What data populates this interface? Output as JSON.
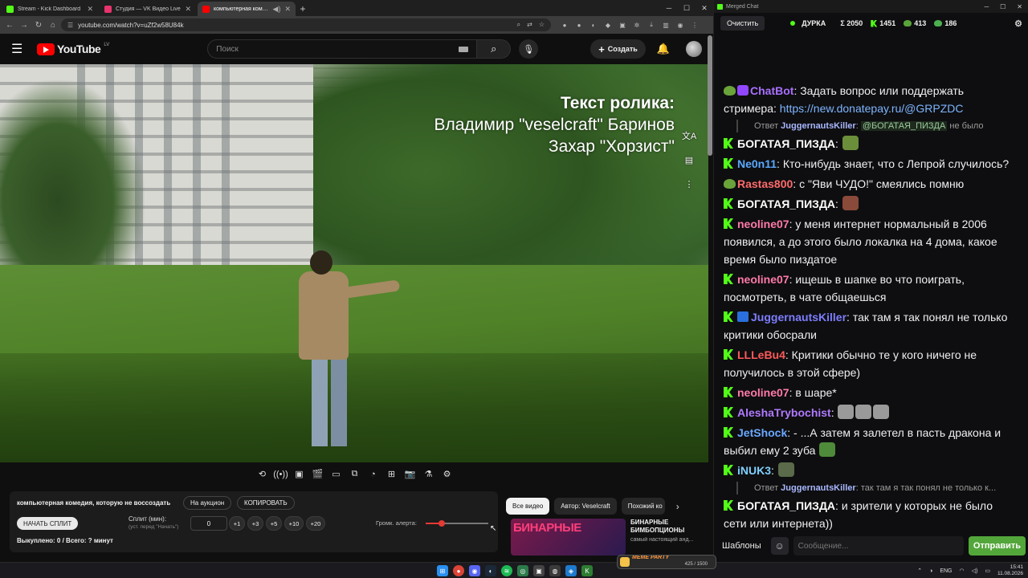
{
  "browser": {
    "tabs": [
      {
        "label": "Stream - Kick Dashboard",
        "fav_color": "#53fc18"
      },
      {
        "label": "Студия — VK Видео Live",
        "fav_color": "#e8336d"
      },
      {
        "label": "компьютерная комедия, к",
        "fav_color": "#ff0000"
      }
    ],
    "url": "youtube.com/watch?v=uZf2w58U84k"
  },
  "youtube": {
    "logo_text": "YouTube",
    "region": "LV",
    "search_placeholder": "Поиск",
    "create_label": "Создать"
  },
  "video": {
    "credits_title": "Текст ролика:",
    "credits_line1": "Владимир \"veselcraft\" Баринов",
    "credits_line2": "Захар \"Хорзист\""
  },
  "panel": {
    "title": "компьютерная комедия, которую не воссоздать",
    "auction_label": "На аукцион",
    "copy_label": "КОПИРОВАТЬ",
    "start_split_label": "НАЧАТЬ СПЛИТ",
    "split_label": "Сплит (мин):",
    "split_hint": "(уст. перед \"Начать\")",
    "split_value": "0",
    "increments": [
      "+1",
      "+3",
      "+5",
      "+10",
      "+20"
    ],
    "paid_text": "Выкуплено: 0 / Всего: ? минут",
    "volume_label": "Громк. алерта:",
    "volume_level": 0.25
  },
  "recommendations": {
    "chips": [
      "Все видео",
      "Автор: Veselcraft",
      "Похожий ко"
    ],
    "video_thumb_text": "БИНАРНЫЕ",
    "video_title": "БИНАРНЫЕ БИМБОПЦИОНЫ",
    "video_subtitle": "самый настоящий анд..."
  },
  "chat": {
    "window_title": "Merged Chat",
    "clear_label": "Очистить",
    "channel": "ДУРКА",
    "total": "Σ 2050",
    "kick_count": "1451",
    "frog_count": "413",
    "vk_count": "186",
    "messages": [
      {
        "type": "msg",
        "badge": "bot",
        "user": "ChatBot",
        "color": "#a970ff",
        "text": "Задать вопрос или поддержать стримера: ",
        "link": "https://new.donatepay.ru/@GRPZDC"
      },
      {
        "type": "reply",
        "label": "Ответ",
        "user": "JuggernautsKiller",
        "mention": "@БОГАТАЯ_ПИЗДА",
        "text": "не было"
      },
      {
        "type": "msg",
        "badge": "kick",
        "user": "БОГАТАЯ_ПИЗДА",
        "color": "#ffffff",
        "text": "",
        "emote": "#6b8e3a"
      },
      {
        "type": "msg",
        "badge": "kick",
        "user": "Ne0n11",
        "color": "#5aa9ff",
        "text": "Кто-нибудь знает, что с Лепрой случилось?"
      },
      {
        "type": "msg",
        "badge": "frog",
        "user": "Rastas800",
        "color": "#ff6b6b",
        "text": "с \"Яви ЧУДО!\"  смеялись помню"
      },
      {
        "type": "msg",
        "badge": "kick",
        "user": "БОГАТАЯ_ПИЗДА",
        "color": "#ffffff",
        "text": "",
        "emote": "#8a4a3a"
      },
      {
        "type": "msg",
        "badge": "kick",
        "user": "neoline07",
        "color": "#ff7aa8",
        "text": "у меня интернет нормальный в 2006 появился, а до этого было локалка на 4 дома, какое время было пиздатое"
      },
      {
        "type": "msg",
        "badge": "kick",
        "user": "neoline07",
        "color": "#ff7aa8",
        "text": "ищешь в шапке во что поиграть, посмотреть, в чате общаешься"
      },
      {
        "type": "msg",
        "badge": "mod",
        "user": "JuggernautsKiller",
        "color": "#7d7dff",
        "text": "так там я так понял не только критики обосрали"
      },
      {
        "type": "msg",
        "badge": "kick",
        "user": "LLLeBu4",
        "color": "#ff5a5a",
        "text": "Критики обычно те у кого ничего не получилось в этой сфере)"
      },
      {
        "type": "msg",
        "badge": "kick",
        "user": "neoline07",
        "color": "#ff7aa8",
        "text": "в шаре*"
      },
      {
        "type": "msg",
        "badge": "kick",
        "user": "AleshaTrybochist",
        "color": "#b07aff",
        "text": "",
        "emotes": 3
      },
      {
        "type": "msg",
        "badge": "kick",
        "user": "JetShock",
        "color": "#6aa8ff",
        "text": "- ...А затем я залетел в пасть дракона и выбил ему 2 зуба",
        "emote": "#4f8a3a"
      },
      {
        "type": "msg",
        "badge": "kick",
        "user": "iNUK3",
        "color": "#7fd0ff",
        "text": "",
        "emote": "#5a6a4a"
      },
      {
        "type": "reply",
        "label": "Ответ",
        "user": "JuggernautsKiller",
        "mention": "",
        "text": "так там я так понял не только к..."
      },
      {
        "type": "msg",
        "badge": "kick",
        "user": "БОГАТАЯ_ПИЗДА",
        "color": "#ffffff",
        "text": "и зрители у которых не было сети или интернета))"
      }
    ],
    "templates_label": "Шаблоны",
    "input_placeholder": "Сообщение...",
    "send_label": "Отправить"
  },
  "taskbar": {
    "widget_label": "MEME PARTY",
    "widget_count": "425 / 1500",
    "lang": "ENG",
    "time": "15:41",
    "date": "11.08.2026"
  }
}
